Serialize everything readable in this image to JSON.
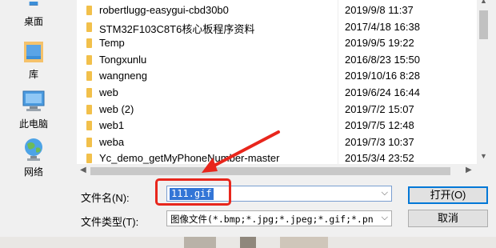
{
  "nav": {
    "items": [
      {
        "label": "桌面",
        "icon": "desktop-icon"
      },
      {
        "label": "库",
        "icon": "library-icon"
      },
      {
        "label": "此电脑",
        "icon": "computer-icon"
      },
      {
        "label": "网络",
        "icon": "network-icon"
      }
    ]
  },
  "files": [
    {
      "name": "robertlugg-easygui-cbd30b0",
      "date": "2019/9/8 11:37"
    },
    {
      "name": "STM32F103C8T6核心板程序资料",
      "date": "2017/4/18 16:38"
    },
    {
      "name": "Temp",
      "date": "2019/9/5 19:22"
    },
    {
      "name": "Tongxunlu",
      "date": "2016/8/23 15:50"
    },
    {
      "name": "wangneng",
      "date": "2019/10/16 8:28"
    },
    {
      "name": "web",
      "date": "2019/6/24 16:44"
    },
    {
      "name": "web (2)",
      "date": "2019/7/2 15:07"
    },
    {
      "name": "web1",
      "date": "2019/7/5 12:48"
    },
    {
      "name": "weba",
      "date": "2019/7/3 10:37"
    },
    {
      "name": "Yc_demo_getMyPhoneNumber-master",
      "date": "2015/3/4 23:52"
    }
  ],
  "form": {
    "filename_label": "文件名(N):",
    "filename_value": "111.gif",
    "filetype_label": "文件类型(T):",
    "filetype_value": "图像文件(*.bmp;*.jpg;*.jpeg;*.gif;*.pn",
    "open_button": "打开(O)",
    "cancel_button": "取消"
  },
  "colors": {
    "selection": "#3375d6",
    "annotation": "#e8261c",
    "folder": "#f2c04b"
  }
}
